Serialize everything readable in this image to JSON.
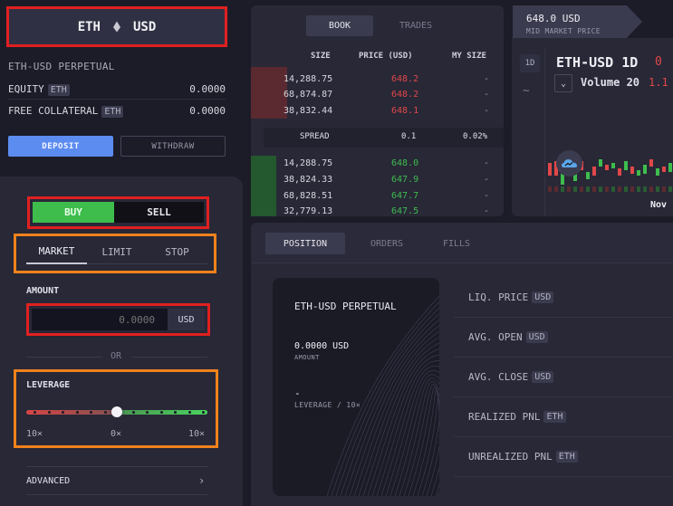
{
  "market": {
    "base": "ETH",
    "quote": "USD",
    "icon": "eth-diamond-icon"
  },
  "account": {
    "title": "ETH-USD PERPETUAL",
    "equity_label": "EQUITY",
    "equity_unit": "ETH",
    "equity_value": "0.0000",
    "collateral_label": "FREE COLLATERAL",
    "collateral_unit": "ETH",
    "collateral_value": "0.0000",
    "deposit_label": "DEPOSIT",
    "withdraw_label": "WITHDRAW"
  },
  "order": {
    "buy_label": "BUY",
    "sell_label": "SELL",
    "types": [
      "MARKET",
      "LIMIT",
      "STOP"
    ],
    "active_type": "MARKET",
    "amount_label": "AMOUNT",
    "amount_placeholder": "0.0000",
    "amount_unit": "USD",
    "or_label": "OR",
    "leverage_label": "LEVERAGE",
    "leverage_value": 0,
    "leverage_ticks": [
      "10×",
      "0×",
      "10×"
    ],
    "advanced_label": "ADVANCED"
  },
  "book": {
    "tabs": [
      "BOOK",
      "TRADES"
    ],
    "active_tab": "BOOK",
    "columns": [
      "SIZE",
      "PRICE (USD)",
      "MY SIZE"
    ],
    "asks": [
      {
        "size": "14,288.75",
        "price": "648.2",
        "my": "-",
        "depth": 0.3
      },
      {
        "size": "68,874.87",
        "price": "648.2",
        "my": "-",
        "depth": 0.3
      },
      {
        "size": "38,832.44",
        "price": "648.1",
        "my": "-",
        "depth": 0.3
      }
    ],
    "spread_label": "SPREAD",
    "spread_value": "0.1",
    "spread_pct": "0.02%",
    "bids": [
      {
        "size": "14,288.75",
        "price": "648.0",
        "my": "-",
        "depth": 0.3
      },
      {
        "size": "38,824.33",
        "price": "647.9",
        "my": "-",
        "depth": 0.3
      },
      {
        "size": "68,828.51",
        "price": "647.7",
        "my": "-",
        "depth": 0.3
      },
      {
        "size": "32,779.13",
        "price": "647.5",
        "my": "-",
        "depth": 0.3
      }
    ]
  },
  "price": {
    "mid": "648.0 USD",
    "mid_label": "MID MARKET PRICE"
  },
  "chart": {
    "interval": "1D",
    "symbol": "ETH-USD",
    "symbol_interval": "1D",
    "change_partial": "0",
    "volume_label": "Volume 20",
    "volume_value": "1.1",
    "month_label": "Nov",
    "colors": {
      "up": "#3ebd4d",
      "down": "#e04848"
    }
  },
  "positions": {
    "tabs": [
      "POSITION",
      "ORDERS",
      "FILLS"
    ],
    "active_tab": "POSITION",
    "card_title": "ETH-USD PERPETUAL",
    "size": "0.0000 USD",
    "size_label": "AMOUNT",
    "leverage": "-",
    "leverage_label": "LEVERAGE / 10×",
    "stats": [
      {
        "label": "LIQ. PRICE",
        "unit": "USD"
      },
      {
        "label": "AVG. OPEN",
        "unit": "USD"
      },
      {
        "label": "AVG. CLOSE",
        "unit": "USD"
      },
      {
        "label": "REALIZED PNL",
        "unit": "ETH"
      },
      {
        "label": "UNREALIZED PNL",
        "unit": "ETH"
      }
    ]
  }
}
